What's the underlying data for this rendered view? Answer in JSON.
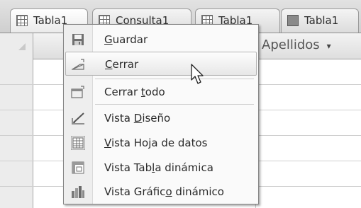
{
  "tabs": [
    {
      "label": "Tabla1",
      "active": true
    },
    {
      "label": "Consulta1",
      "active": false
    },
    {
      "label": "Tabla1",
      "active": false
    },
    {
      "label": "Tabla1",
      "active": false
    }
  ],
  "datasheet": {
    "column_header": "Apellidos",
    "column_header_dropdown": "▾"
  },
  "menu": {
    "items": [
      {
        "pre": "",
        "key": "G",
        "post": "uardar",
        "icon": "save-icon"
      },
      {
        "pre": "",
        "key": "C",
        "post": "errar",
        "icon": "close-window-icon",
        "hover": true
      },
      {
        "pre": "Cerrar ",
        "key": "t",
        "post": "odo",
        "icon": "close-all-icon"
      },
      {
        "pre": "Vista ",
        "key": "D",
        "post": "iseño",
        "icon": "design-view-icon"
      },
      {
        "pre": "",
        "key": "V",
        "post": "ista Hoja de datos",
        "icon": "datasheet-view-icon"
      },
      {
        "pre": "Vista Tab",
        "key": "l",
        "post": "a dinámica",
        "icon": "pivot-table-icon"
      },
      {
        "pre": "Vista Gráfic",
        "key": "o",
        "post": " dinámico",
        "icon": "pivot-chart-icon"
      }
    ]
  }
}
